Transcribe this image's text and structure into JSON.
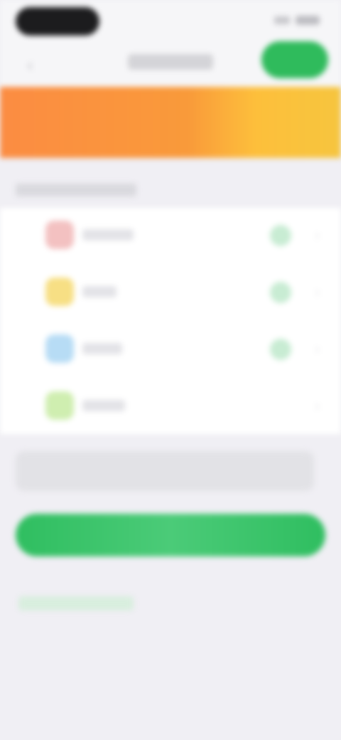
{
  "status_bar": {
    "icons": [
      "signal-icon",
      "wifi-icon",
      "battery-icon"
    ]
  },
  "nav": {
    "back_icon": "chevron-left-icon",
    "title": "",
    "action_label": ""
  },
  "hero": {
    "text": ""
  },
  "section": {
    "header": ""
  },
  "list": {
    "items": [
      {
        "label": "",
        "icon_color": "#f3c1c1",
        "checked": true
      },
      {
        "label": "",
        "icon_color": "#f7df84",
        "checked": true
      },
      {
        "label": "",
        "icon_color": "#b7dcf5",
        "checked": true
      },
      {
        "label": "",
        "icon_color": "#cfeeb0",
        "checked": false
      }
    ]
  },
  "info": {
    "text": ""
  },
  "actions": {
    "primary_label": "",
    "secondary_label": ""
  },
  "colors": {
    "accent_green": "#2fbb5c",
    "hero_orange": "#fb8c42",
    "hero_yellow": "#fdbf3b",
    "background": "#f0eff4"
  }
}
